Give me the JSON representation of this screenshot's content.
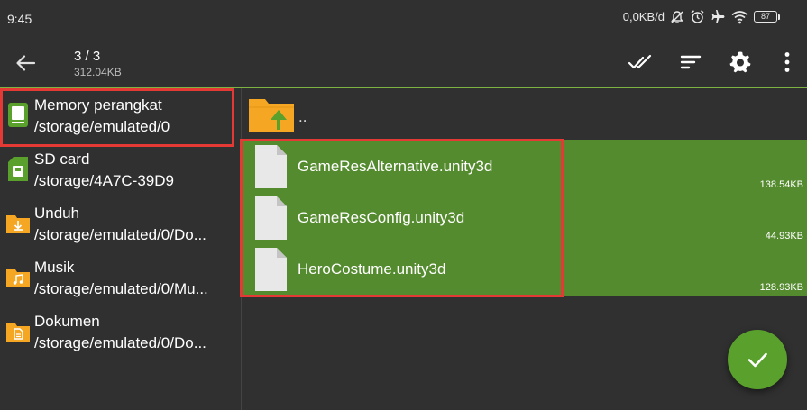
{
  "status_bar": {
    "time": "9:45",
    "network_speed": "0,0KB/d",
    "battery_level": "87",
    "icons": [
      "bell-off-icon",
      "alarm-icon",
      "airplane-icon",
      "wifi-icon",
      "battery-icon"
    ]
  },
  "toolbar": {
    "selection_count": "3 / 3",
    "selection_size": "312.04KB",
    "actions": [
      "select-all-icon",
      "sort-icon",
      "settings-icon",
      "more-icon"
    ]
  },
  "sidebar": {
    "items": [
      {
        "name": "Memory perangkat",
        "path": "/storage/emulated/0",
        "icon": "device-storage-icon",
        "highlighted": true
      },
      {
        "name": "SD card",
        "path": "/storage/4A7C-39D9",
        "icon": "sd-card-icon",
        "highlighted": false
      },
      {
        "name": "Unduh",
        "path": "/storage/emulated/0/Do...",
        "icon": "download-folder-icon",
        "highlighted": false
      },
      {
        "name": "Musik",
        "path": "/storage/emulated/0/Mu...",
        "icon": "music-folder-icon",
        "highlighted": false
      },
      {
        "name": "Dokumen",
        "path": "/storage/emulated/0/Do...",
        "icon": "document-folder-icon",
        "highlighted": false
      }
    ]
  },
  "file_list": {
    "parent_label": "..",
    "files": [
      {
        "name": "GameResAlternative.unity3d",
        "size": "138.54KB",
        "selected": true
      },
      {
        "name": "GameResConfig.unity3d",
        "size": "44.93KB",
        "selected": true
      },
      {
        "name": "HeroCostume.unity3d",
        "size": "128.93KB",
        "selected": true
      }
    ]
  },
  "colors": {
    "accent": "#7cb342",
    "selection": "#558b2f",
    "fab": "#5aa02c",
    "highlight_box": "#e53935",
    "folder": "#f5a623"
  },
  "fab": {
    "icon": "check-icon"
  }
}
